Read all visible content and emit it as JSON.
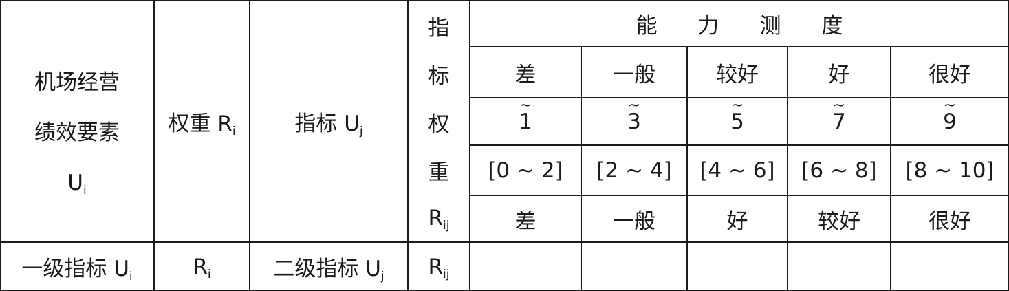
{
  "header": {
    "factor_col": [
      "机场经营",
      "绩效要素",
      "U"
    ],
    "factor_sub": "i",
    "weight_label": "权重 R",
    "weight_sub": "i",
    "indicator_label": "指标 U",
    "indicator_sub": "j",
    "indicator_weight_chars": [
      "指",
      "标",
      "权",
      "重",
      "R"
    ],
    "indicator_weight_sub": "ij",
    "ability_title": "能力测度"
  },
  "grades_top": [
    "差",
    "一般",
    "较好",
    "好",
    "很好"
  ],
  "fuzzy_numbers": [
    "1",
    "3",
    "5",
    "7",
    "9"
  ],
  "intervals": [
    "[0 ~ 2]",
    "[2 ~ 4]",
    "[4 ~ 6]",
    "[6 ~ 8]",
    "[8 ~ 10]"
  ],
  "grades_bottom": [
    "差",
    "一般",
    "好",
    "较好",
    "很好"
  ],
  "data_row": {
    "level1_label": "一级指标 U",
    "level1_sub": "i",
    "weight": "R",
    "weight_sub": "i",
    "level2_label": "二级指标 U",
    "level2_sub": "j",
    "indicator_weight": "R",
    "indicator_weight_sub": "ij"
  }
}
